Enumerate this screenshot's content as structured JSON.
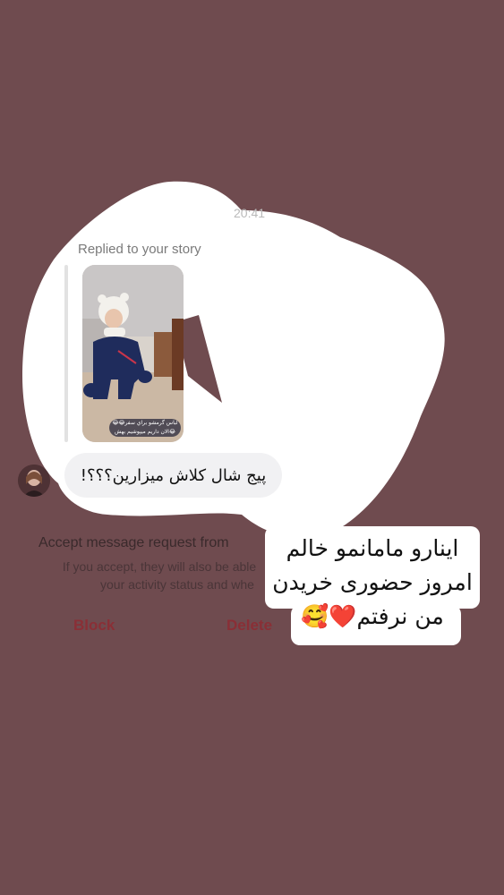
{
  "chat": {
    "timestamp": "20:41",
    "replied_label": "Replied to your story",
    "story_caption": "😂😂لباس گرمشو براي سفر الان داریم میپوشیم بهش😂",
    "message": "پیج شال کلاش میزارین؟؟؟!"
  },
  "request": {
    "title": "Accept message request from",
    "subtitle_line1": "If you accept, they will also be able",
    "subtitle_line2": "your activity status and whe",
    "block_label": "Block",
    "delete_label": "Delete"
  },
  "sticker": {
    "line1": "اینارو مامانمو خالم",
    "line2": "امروز حضوری خریدن",
    "line3": "من نرفتم",
    "emoji_heart": "❤️",
    "emoji_smile": "🥰"
  },
  "colors": {
    "background": "#6f4b4f",
    "overlay": "#ffffff",
    "danger": "#8a2f36"
  }
}
